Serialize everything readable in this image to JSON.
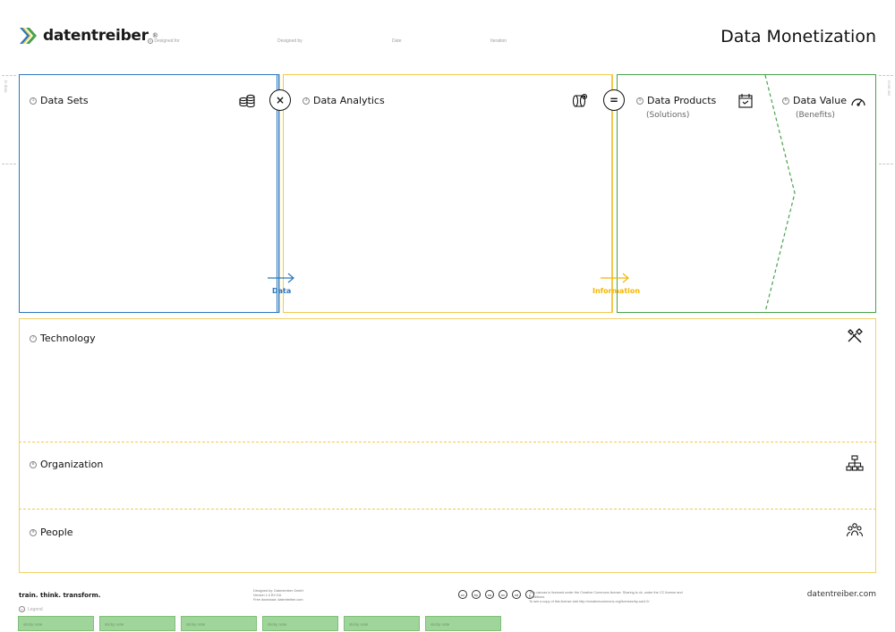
{
  "brand": {
    "name": "datentreiber",
    "reg": "®"
  },
  "page_title": "Data Monetization",
  "meta": [
    {
      "label": "Designed for"
    },
    {
      "label": "Designed by"
    },
    {
      "label": "Date"
    },
    {
      "label": "Iteration"
    }
  ],
  "blocks": {
    "data_sets": {
      "num": "1",
      "title": "Data Sets"
    },
    "data_analytics": {
      "num": "3",
      "title": "Data Analytics"
    },
    "data_products": {
      "num": "5",
      "title": "Data Products",
      "subtitle": "(Solutions)"
    },
    "data_value": {
      "num": "6",
      "title": "Data Value",
      "subtitle": "(Benefits)"
    },
    "technology": {
      "num": "7",
      "title": "Technology"
    },
    "organization": {
      "num": "8",
      "title": "Organization"
    },
    "people": {
      "num": "9",
      "title": "People"
    }
  },
  "operators": {
    "multiply": "×",
    "equals": "="
  },
  "flows": {
    "data": {
      "label": "Data",
      "color": "#2b77bd"
    },
    "information": {
      "label": "Information",
      "color": "#f2b705"
    }
  },
  "colors": {
    "blue": "#2b77bd",
    "yellow": "#f2c94c",
    "green": "#48a24a"
  },
  "side_tabs": {
    "left": "in data",
    "right": "Cost out"
  },
  "footer": {
    "tagline": "train. think. transform.",
    "designer_lines": [
      "Designed by: Datentreiber GmbH",
      "Version 1.0 BY-SA",
      "Free download: datentreiber.com"
    ],
    "license_lines": [
      "This canvas is licensed under the Creative Commons license. Sharing is ok, under the CC license and conditions.",
      "To see a copy of this license visit http://creativecommons.org/licenses/by-sa/4.0/"
    ],
    "cc_icons": [
      "cc",
      "by",
      "sa",
      "nc",
      "nd",
      "c"
    ],
    "url": "datentreiber.com"
  },
  "legend": {
    "label": "Legend",
    "items": [
      "sticky note",
      "sticky note",
      "sticky note",
      "sticky note",
      "sticky note",
      "sticky note"
    ]
  },
  "icons": {
    "data_sets": "coins-stack-icon",
    "data_analytics": "cylinder-gear-icon",
    "data_products": "calendar-product-icon",
    "data_value": "speedometer-icon",
    "technology": "tools-icon",
    "organization": "org-chart-icon",
    "people": "people-group-icon"
  }
}
